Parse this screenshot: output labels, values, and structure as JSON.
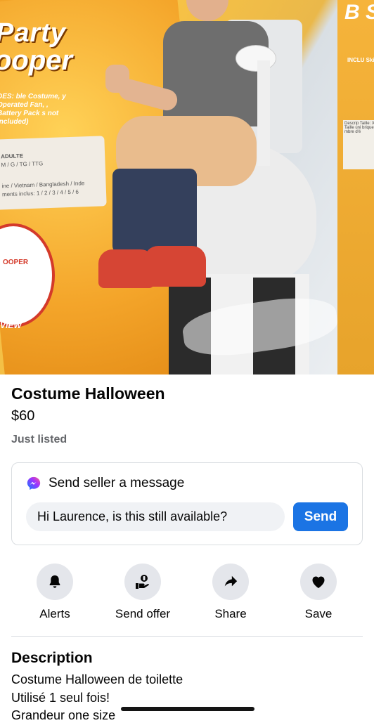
{
  "listing": {
    "title": "Costume Halloween",
    "price": "$60",
    "listed": "Just listed"
  },
  "message": {
    "heading": "Send seller a message",
    "input_value": "Hi Laurence, is this still available?",
    "send_label": "Send"
  },
  "actions": [
    {
      "label": "Alerts",
      "icon": "bell-icon"
    },
    {
      "label": "Send offer",
      "icon": "offer-hand-icon"
    },
    {
      "label": "Share",
      "icon": "share-arrow-icon"
    },
    {
      "label": "Save",
      "icon": "heart-icon"
    }
  ],
  "description": {
    "heading": "Description",
    "lines": [
      "Costume Halloween de toilette",
      "Utilisé 1 seul fois!",
      "Grandeur one size"
    ]
  },
  "photo": {
    "brand_line1": "Party",
    "brand_line2": "ooper",
    "includes": "DES: ble Costume, y Operated Fan, , Battery Pack s not included)",
    "size_label": "ADULTE",
    "size_values": "M / G / TG / TTG",
    "origin": "ine / Vietnam / Bangladesh / Inde",
    "elements": "ments inclus: 1 / 2 / 3 / 4 / 5 / 6",
    "badge": "OOPER",
    "view": "VIEW",
    "right_brand": "B S",
    "right_incl": "INCLU Skinsu",
    "right_desc": "Descrip Taille: XS Taille uni brique à mbre d'é"
  },
  "colors": {
    "accent": "#1b74e4",
    "secondary_text": "#65676b",
    "button_bg": "#e4e6eb",
    "input_bg": "#f0f2f5"
  }
}
